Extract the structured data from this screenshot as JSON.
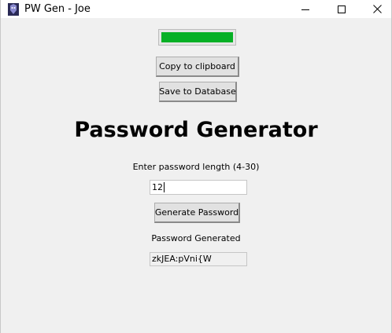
{
  "window": {
    "title": "PW Gen - Joe",
    "app_icon": "app-icon",
    "controls": {
      "minimize_icon": "minimize-icon",
      "maximize_icon": "maximize-icon",
      "close_icon": "close-icon"
    }
  },
  "strength_meter": {
    "level_percent": 100,
    "color": "#06b025"
  },
  "buttons": {
    "copy_label": "Copy to clipboard",
    "save_label": "Save to Database",
    "generate_label": "Generate Password"
  },
  "main": {
    "heading": "Password Generator",
    "length_label": "Enter password length (4-30)",
    "length_value": "12",
    "generated_label": "Password Generated",
    "generated_value": "zkJEA:pVni{W"
  }
}
